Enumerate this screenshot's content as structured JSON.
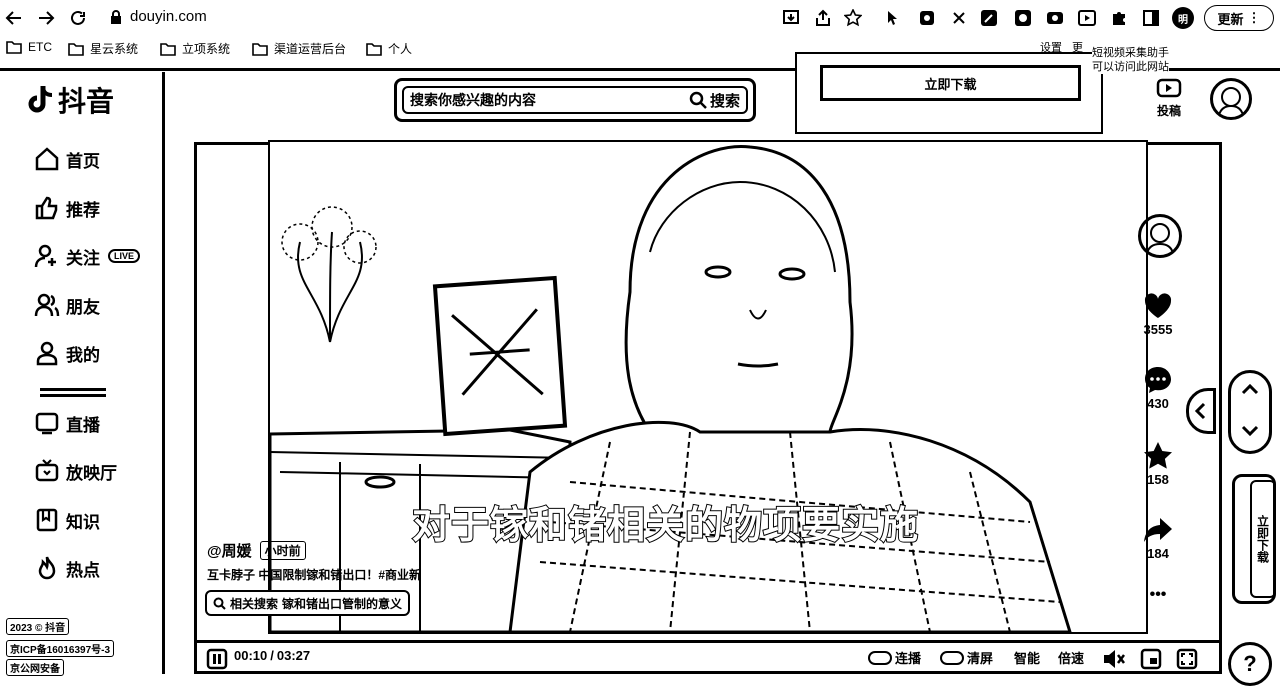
{
  "browser": {
    "url": "douyin.com",
    "update_label": "更新",
    "profile_initials": "明",
    "bookmarks": [
      "ETC",
      "星云系统",
      "立项系统",
      "渠道运营后台",
      "个人"
    ]
  },
  "extension_popup": {
    "settings_label": "设置",
    "more_label": "更",
    "title": "短视频采集助手",
    "note": "可以访问此网站",
    "download_label": "立即下载"
  },
  "header": {
    "logo_text": "抖音",
    "search_placeholder": "搜索你感兴趣的内容",
    "search_button": "搜索",
    "upload_label": "投稿"
  },
  "sidebar": {
    "items": [
      {
        "label": "首页",
        "icon": "home-icon"
      },
      {
        "label": "推荐",
        "icon": "thumbs-up-icon"
      },
      {
        "label": "关注",
        "icon": "follow-icon",
        "badge": "LIVE"
      },
      {
        "label": "朋友",
        "icon": "friends-icon"
      },
      {
        "label": "我的",
        "icon": "user-icon"
      },
      {
        "label": "直播",
        "icon": "live-icon"
      },
      {
        "label": "放映厅",
        "icon": "tv-icon"
      },
      {
        "label": "知识",
        "icon": "book-icon"
      },
      {
        "label": "热点",
        "icon": "flame-icon"
      }
    ],
    "footer": [
      "2023 © 抖音",
      "京ICP备16016397号-3",
      "京公网安备"
    ]
  },
  "video": {
    "subtitle": "对于镓和锗相关的物项要实施",
    "author": "@周媛",
    "time_ago": "小时前",
    "description": "互卡脖子  中国限制镓和锗出口！#商业新",
    "related_prefix": "相关搜索",
    "related_query": "镓和锗出口管制的意义"
  },
  "rail": {
    "likes": "3555",
    "comments": "430",
    "favorites": "158",
    "shares": "184",
    "more": "•••"
  },
  "controls": {
    "current_time": "00:10",
    "separator": "/",
    "duration": "03:27",
    "autoplay": "连播",
    "clear_screen": "清屏",
    "smart": "智能",
    "speed": "倍速",
    "side_download": "立即下载"
  }
}
